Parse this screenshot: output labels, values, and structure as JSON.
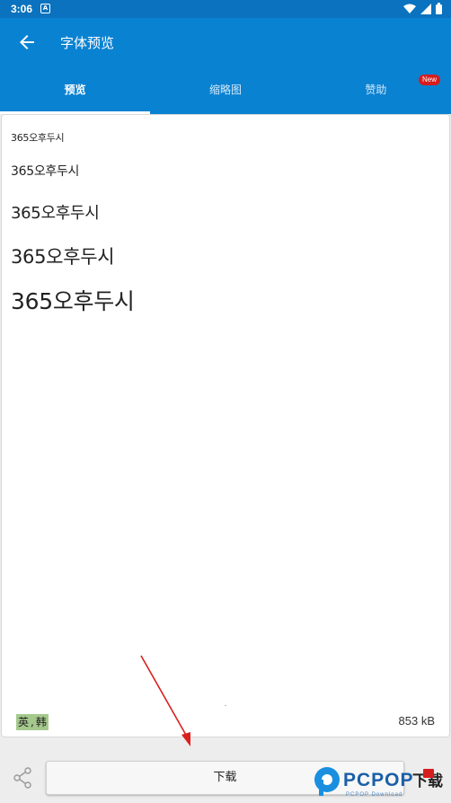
{
  "status_bar": {
    "time": "3:06",
    "app_indicator": "A"
  },
  "app_bar": {
    "title": "字体预览",
    "back_icon": "arrow-back-icon"
  },
  "tabs": [
    {
      "label": "预览",
      "active": true
    },
    {
      "label": "缩略图",
      "active": false
    },
    {
      "label": "赞助",
      "active": false,
      "badge": "New"
    }
  ],
  "preview": {
    "samples": [
      "365오후두시",
      "365오후두시",
      "365오후두시",
      "365오후두시",
      "365오후두시"
    ],
    "languages": {
      "first": "英",
      "separator": ",",
      "second": "韩"
    },
    "file_size": "853 kB"
  },
  "bottom_bar": {
    "download_label": "下载",
    "share_icon": "share-icon"
  },
  "watermark": {
    "brand": "PCPOP",
    "suffix": "下载",
    "sub": "PCPOP Download"
  },
  "colors": {
    "primary": "#0a82d2",
    "status": "#0a72be",
    "badge": "#d71d1d",
    "lang_tag": "#a5c98d",
    "arrow": "#d9201f"
  }
}
